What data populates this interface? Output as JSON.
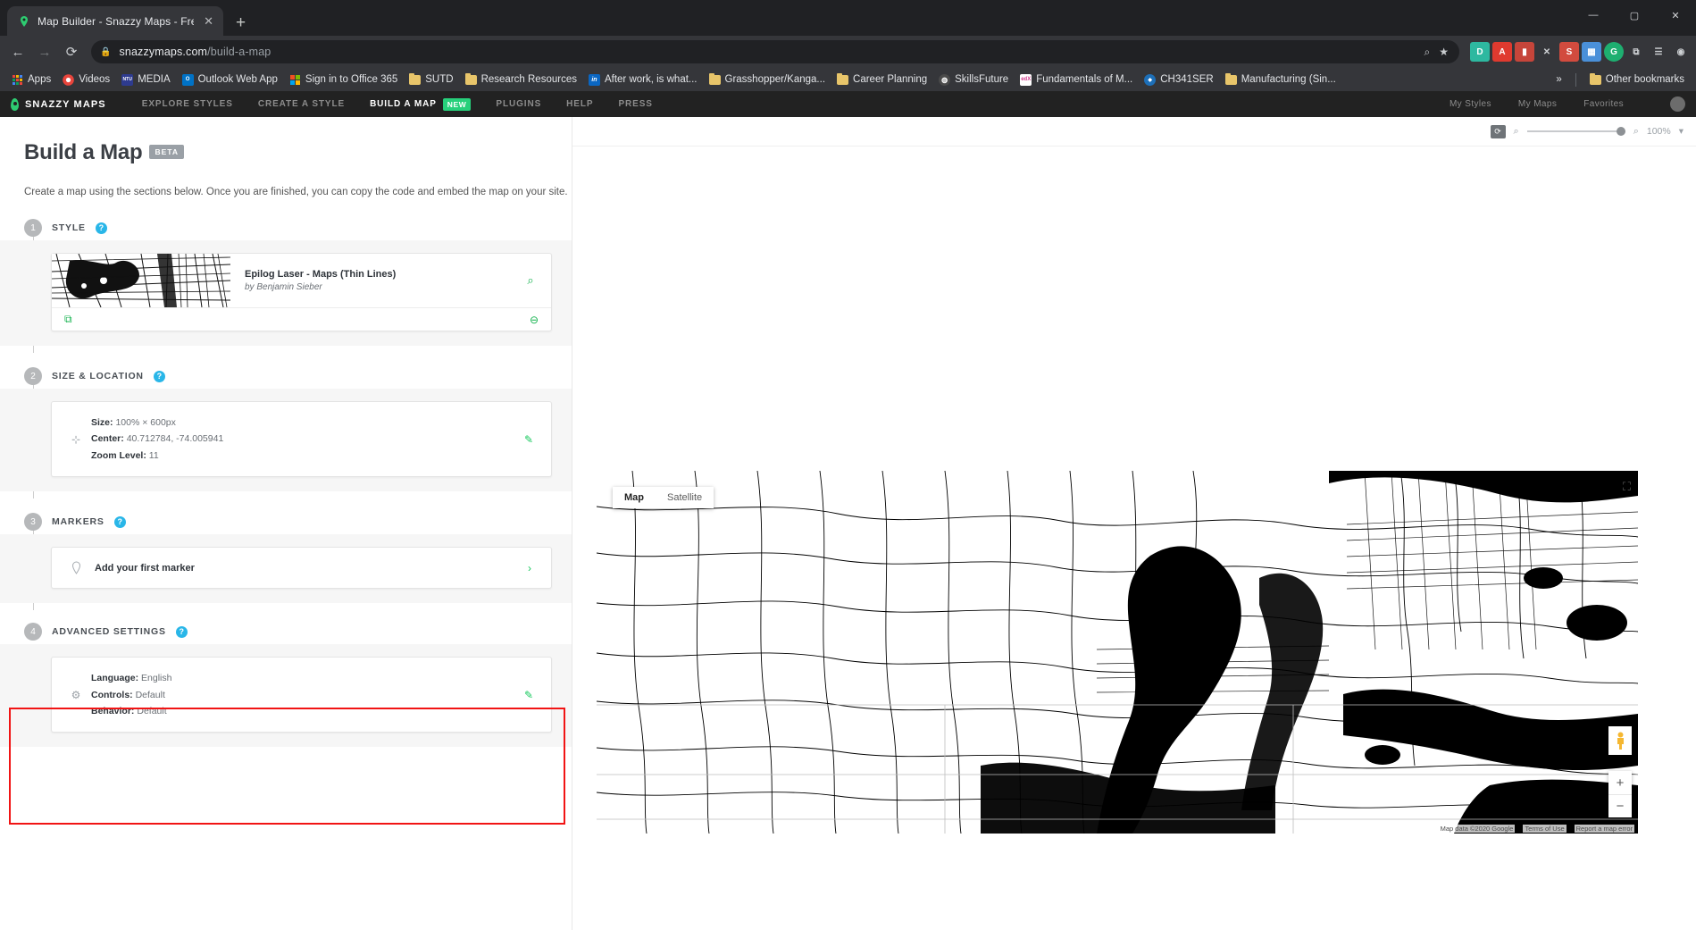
{
  "browser": {
    "tab": {
      "title": "Map Builder - Snazzy Maps - Free",
      "favicon": "map-pin-icon",
      "close": "✕"
    },
    "new_tab": "+",
    "window_controls": {
      "minimize": "—",
      "maximize": "▢",
      "close": "✕"
    },
    "nav": {
      "back": "←",
      "forward": "→",
      "reload": "⟳"
    },
    "omnibox": {
      "lock": "lock-icon",
      "url_host": "snazzymaps.com",
      "url_path": "/build-a-map",
      "search_icon": "⌕",
      "star_icon": "★"
    },
    "extensions": [
      {
        "name": "dashlane-extension",
        "label": "D",
        "color": "#2eb8a0"
      },
      {
        "name": "adobe-acrobat-extension",
        "label": "A",
        "color": "#e03a2f"
      },
      {
        "name": "adblock-extension",
        "label": "▮",
        "color": "#c6453a"
      },
      {
        "name": "close-extension",
        "label": "✕",
        "color": "#5f6368"
      },
      {
        "name": "stylus-extension",
        "label": "S",
        "color": "#d24b3e"
      },
      {
        "name": "grid-extension",
        "label": "▦",
        "color": "#4a90d9"
      },
      {
        "name": "grammarly-extension",
        "label": "G",
        "color": "#1eaf70"
      },
      {
        "name": "puzzle-extension",
        "label": "⧉",
        "color": "#5f6368"
      },
      {
        "name": "readlist-extension",
        "label": "☰",
        "color": "#5f6368"
      },
      {
        "name": "profile-avatar",
        "label": "◉",
        "color": "#5f6368"
      }
    ],
    "bookmarks": [
      {
        "label": "Apps",
        "icon": "apps-grid-icon",
        "color": "#d8453a"
      },
      {
        "label": "Videos",
        "icon": "chrome-icon",
        "color": "#e8453c"
      },
      {
        "label": "MEDIA",
        "icon": "ntu-icon",
        "color": "#2e3b8f"
      },
      {
        "label": "Outlook Web App",
        "icon": "outlook-icon",
        "color": "#0072c6"
      },
      {
        "label": "Sign in to Office 365",
        "icon": "office-icon",
        "color": "#eb3c00"
      },
      {
        "label": "SUTD",
        "icon": "folder-icon",
        "color": "#e8c56a"
      },
      {
        "label": "Research Resources",
        "icon": "folder-icon",
        "color": "#e8c56a"
      },
      {
        "label": "After work, is what...",
        "icon": "linkedin-icon",
        "color": "#0a66c2"
      },
      {
        "label": "Grasshopper/Kanga...",
        "icon": "folder-icon",
        "color": "#e8c56a"
      },
      {
        "label": "Career Planning",
        "icon": "folder-icon",
        "color": "#e8c56a"
      },
      {
        "label": "SkillsFuture",
        "icon": "globe-icon",
        "color": "#4a4a4a"
      },
      {
        "label": "Fundamentals of M...",
        "icon": "edx-icon",
        "color": "#ffffff"
      },
      {
        "label": "CH341SER",
        "icon": "blue-circle-icon",
        "color": "#1d6fb8"
      },
      {
        "label": "Manufacturing (Sin...",
        "icon": "folder-icon",
        "color": "#e8c56a"
      }
    ],
    "bookmarks_overflow": "»",
    "other_bookmarks": {
      "label": "Other bookmarks",
      "icon": "folder-icon"
    }
  },
  "site_nav": {
    "logo": "SNAZZY MAPS",
    "links": [
      {
        "label": "EXPLORE STYLES",
        "active": false
      },
      {
        "label": "CREATE A STYLE",
        "active": false
      },
      {
        "label": "BUILD A MAP",
        "active": true,
        "badge": "NEW"
      },
      {
        "label": "PLUGINS",
        "active": false
      },
      {
        "label": "HELP",
        "active": false
      },
      {
        "label": "PRESS",
        "active": false
      }
    ],
    "account_links": [
      {
        "label": "My Styles"
      },
      {
        "label": "My Maps"
      },
      {
        "label": "Favorites"
      }
    ]
  },
  "builder": {
    "title": "Build a Map",
    "badge": "BETA",
    "intro": "Create a map using the sections below. Once you are finished, you can copy the code and embed the map on your site.",
    "sections": [
      {
        "number": "1",
        "title": "STYLE",
        "help": "?",
        "style": {
          "name": "Epilog Laser - Maps (Thin Lines)",
          "author": "by Benjamin Sieber",
          "search_icon": "search-icon",
          "edit_icon": "external-link-icon",
          "remove_icon": "remove-circle-icon"
        }
      },
      {
        "number": "2",
        "title": "SIZE & LOCATION",
        "help": "?",
        "icon": "crosshair-icon",
        "lines": [
          {
            "label": "Size:",
            "value": "100% × 600px"
          },
          {
            "label": "Center:",
            "value": "40.712784, -74.005941"
          },
          {
            "label": "Zoom Level:",
            "value": "11"
          }
        ],
        "edit_icon": "pencil-icon"
      },
      {
        "number": "3",
        "title": "MARKERS",
        "help": "?",
        "icon": "map-pin-outline-icon",
        "label": "Add your first marker",
        "chevron": "›"
      },
      {
        "number": "4",
        "title": "ADVANCED SETTINGS",
        "help": "?",
        "icon": "gear-icon",
        "highlighted": true,
        "highlight_color": "#f11414",
        "lines": [
          {
            "label": "Language:",
            "value": "English"
          },
          {
            "label": "Controls:",
            "value": "Default"
          },
          {
            "label": "Behavior:",
            "value": "Default"
          }
        ],
        "edit_icon": "pencil-icon"
      }
    ],
    "tools": [
      {
        "name": "save-map-tool",
        "glyph": "save-icon"
      },
      {
        "name": "view-code-tool",
        "glyph": "code-icon"
      },
      {
        "name": "reset-map-tool",
        "glyph": "reset-circle-icon"
      }
    ],
    "collapse": "‹",
    "help_button": "?",
    "help_caret": "◄",
    "accent_color": "#13c162"
  },
  "preview": {
    "zoom_controls": {
      "reset_icon": "reset-zoom-icon",
      "zoom_out_icon": "zoom-out-icon",
      "zoom_in_icon": "zoom-in-icon",
      "level": "100%",
      "caret": "▾"
    },
    "map": {
      "types": [
        {
          "label": "Map",
          "active": true
        },
        {
          "label": "Satellite",
          "active": false
        }
      ],
      "fullscreen_icon": "fullscreen-icon",
      "pegman_icon": "street-view-pegman-icon",
      "zoom_in": "+",
      "zoom_out": "−",
      "attribution": [
        "Map data ©2020 Google",
        "Terms of Use",
        "Report a map error"
      ]
    }
  }
}
